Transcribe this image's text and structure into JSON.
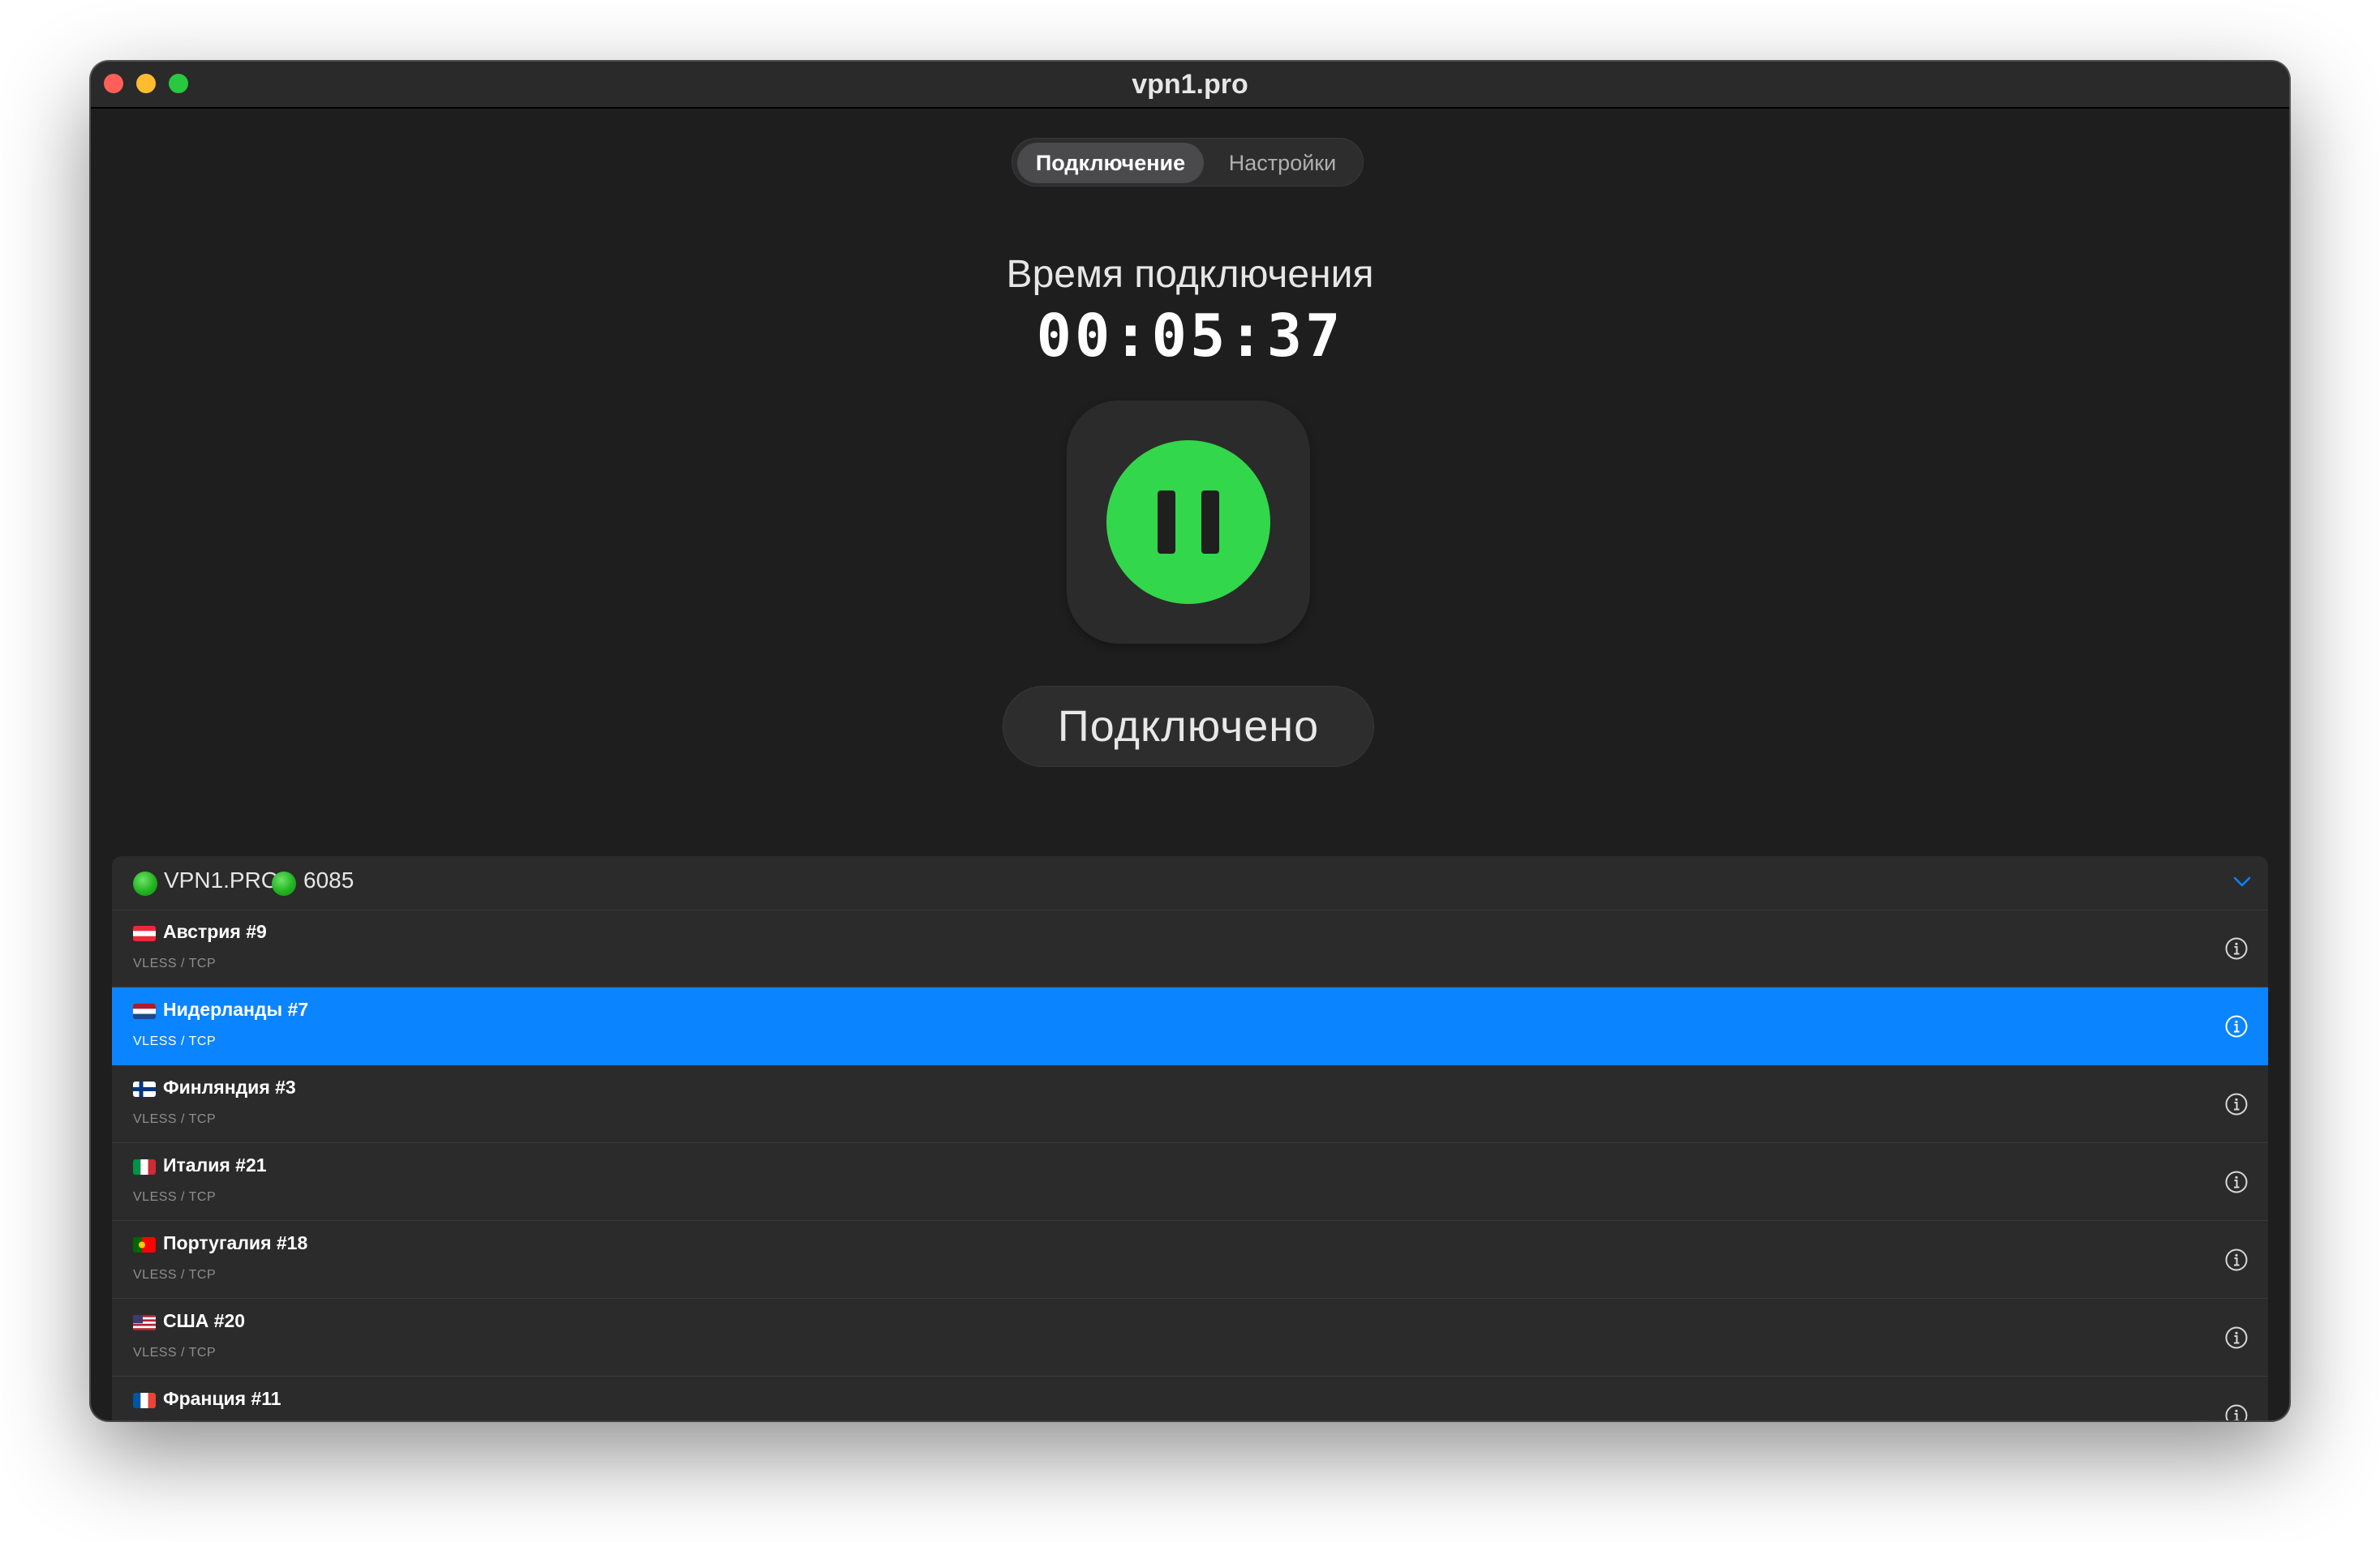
{
  "window": {
    "title": "vpn1.pro"
  },
  "tabs": [
    {
      "label": "Подключение",
      "active": true
    },
    {
      "label": "Настройки",
      "active": false
    }
  ],
  "connection": {
    "time_label": "Время подключения",
    "timer": "00:05:37",
    "status": "Подключено",
    "button_icon": "pause-icon",
    "accent_color": "#32d74b"
  },
  "server_group": {
    "name": "VPN1.PRO",
    "count": "6085",
    "status_icon": "green-circle-icon",
    "expand_icon": "chevron-down-icon"
  },
  "servers": [
    {
      "flag": "austria-flag-icon",
      "name": "Австрия #9",
      "protocol": "VLESS / TCP",
      "selected": false
    },
    {
      "flag": "netherlands-flag-icon",
      "name": "Нидерланды #7",
      "protocol": "VLESS / TCP",
      "selected": true
    },
    {
      "flag": "finland-flag-icon",
      "name": "Финляндия #3",
      "protocol": "VLESS / TCP",
      "selected": false
    },
    {
      "flag": "italy-flag-icon",
      "name": "Италия #21",
      "protocol": "VLESS / TCP",
      "selected": false
    },
    {
      "flag": "portugal-flag-icon",
      "name": "Португалия #18",
      "protocol": "VLESS / TCP",
      "selected": false
    },
    {
      "flag": "usa-flag-icon",
      "name": "США #20",
      "protocol": "VLESS / TCP",
      "selected": false
    },
    {
      "flag": "france-flag-icon",
      "name": "Франция #11",
      "protocol": "",
      "selected": false
    }
  ],
  "colors": {
    "selection": "#0a84ff",
    "background": "#1e1e1e",
    "panel": "#2b2b2b"
  }
}
